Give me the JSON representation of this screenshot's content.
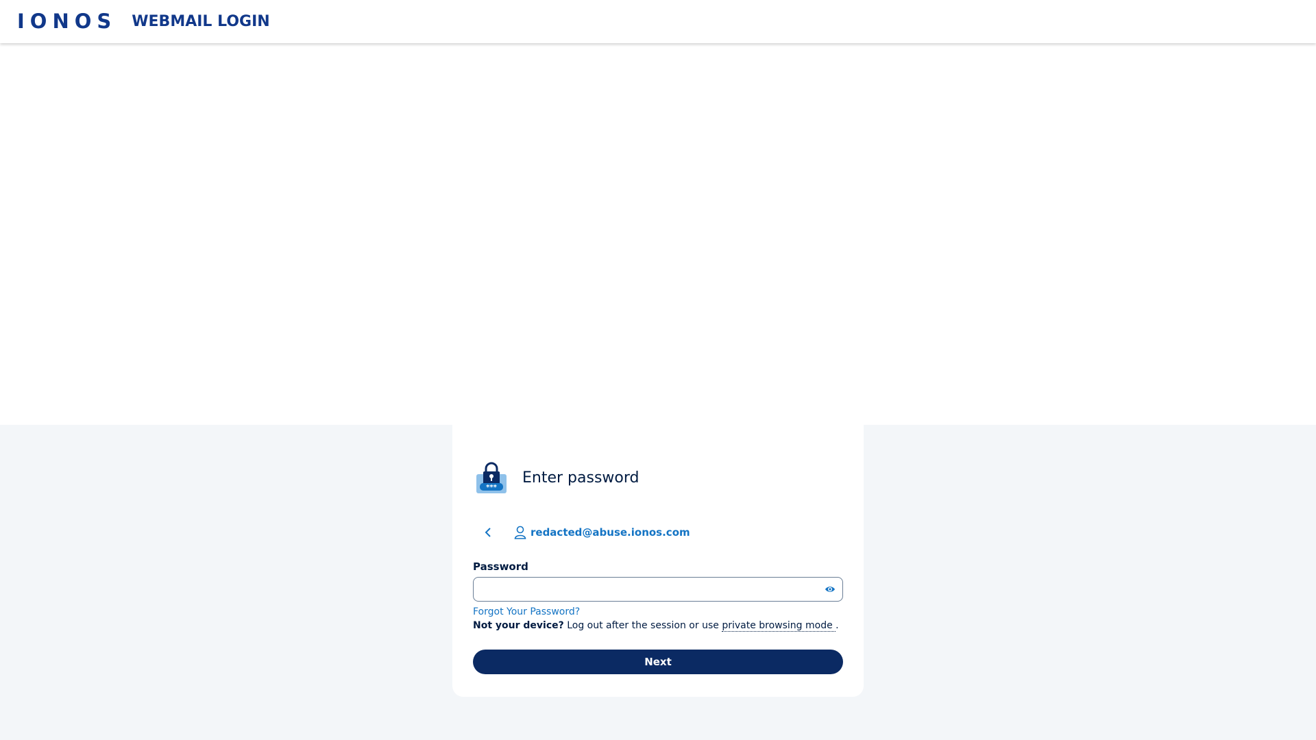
{
  "header": {
    "logo": "IONOS",
    "title": "WEBMAIL LOGIN"
  },
  "card": {
    "title": "Enter password",
    "lock_icon": "password-lock-icon",
    "user_icon": "user-icon",
    "back_icon": "chevron-left-icon",
    "email": "redacted@abuse.ionos.com",
    "password_label": "Password",
    "password_value": "",
    "toggle_icon": "eye-icon",
    "forgot_label": "Forgot Your Password?",
    "note_bold": "Not your device?",
    "note_text": " Log out after the session or use ",
    "note_link": "private browsing mode ",
    "note_end": ".",
    "next_label": "Next"
  },
  "colors": {
    "brand": "#11388a",
    "link": "#1474c4",
    "button": "#0b2a63",
    "page_bg": "#f3f6f9"
  }
}
